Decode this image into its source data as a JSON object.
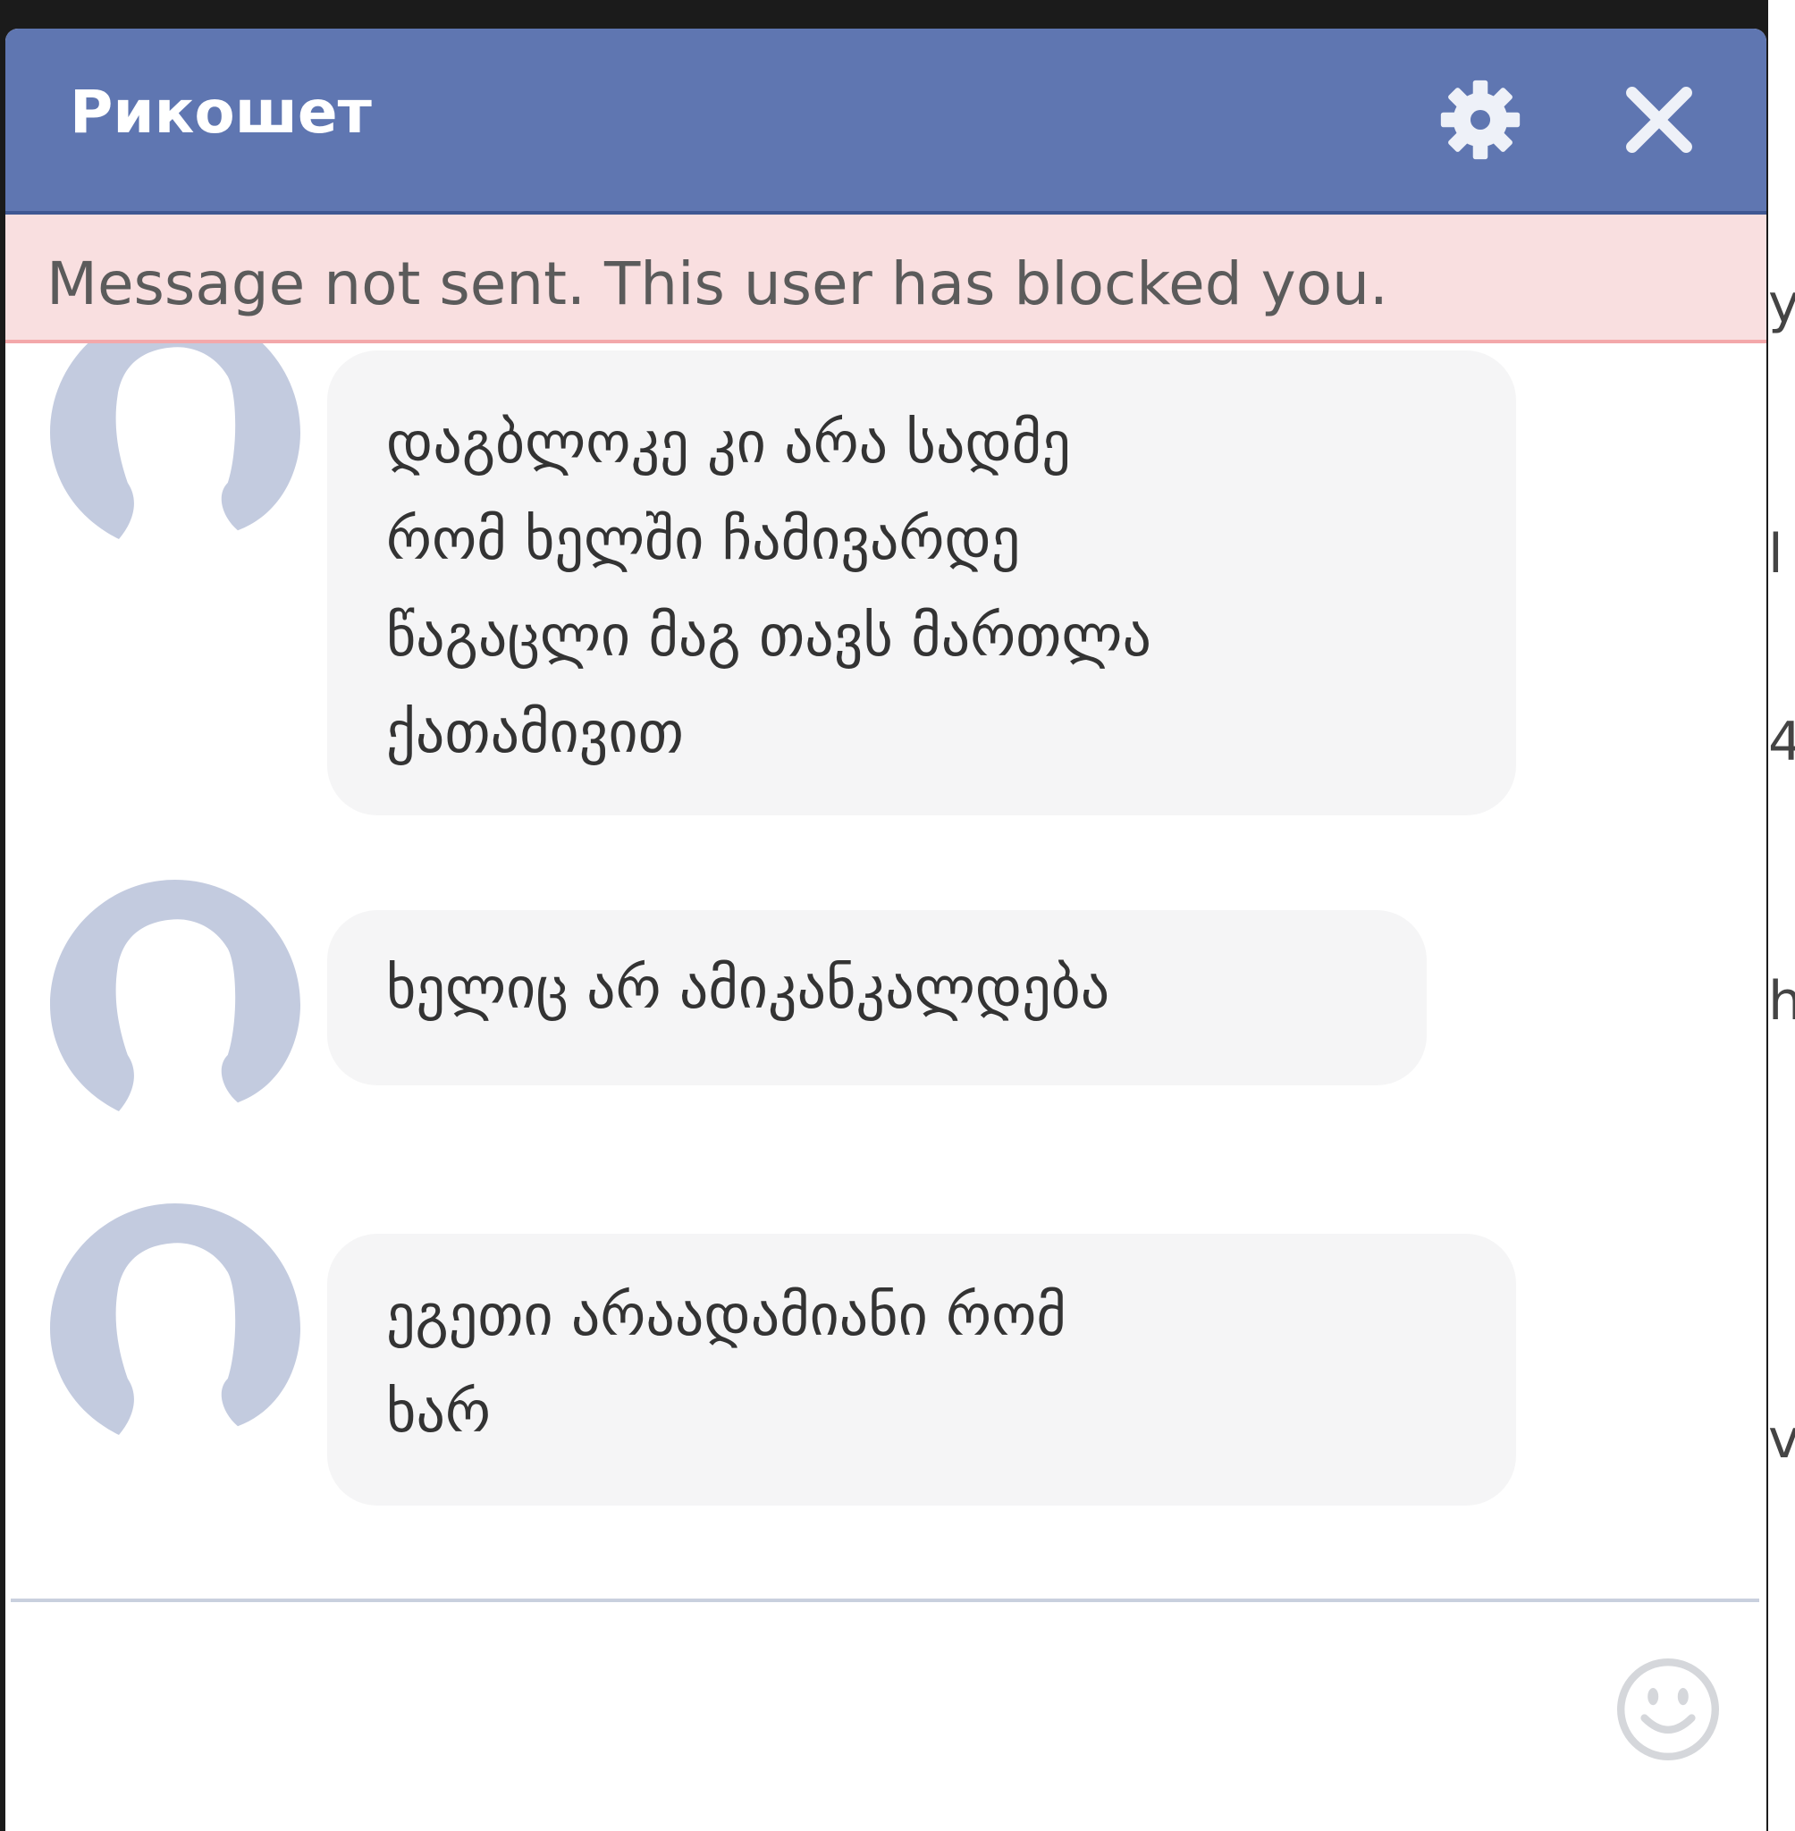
{
  "chat": {
    "title": "Рикошет",
    "settings_icon": "gear-icon",
    "close_icon": "close-icon",
    "alert": "Message not sent. This user has blocked you."
  },
  "messages": [
    {
      "avatar": "default-avatar-silhouette",
      "lines": [
        "დაგბლოკე კი არა სადმე",
        "რომ ხელში ჩამივარდე",
        "წაგაცლი მაგ თავს მართლა",
        "ქათამივით"
      ]
    },
    {
      "avatar": "default-avatar-silhouette",
      "lines": [
        "ხელიც არ ამიკანკალდება"
      ]
    },
    {
      "avatar": "default-avatar-silhouette",
      "lines": [
        "ეგეთი არაადამიანი რომ",
        "ხარ"
      ]
    }
  ],
  "composer": {
    "value": "",
    "emoji_icon": "smiley-icon"
  },
  "background_strip": [
    "y",
    "l",
    "4",
    "hi",
    "v"
  ],
  "colors": {
    "header": "#5f76b1",
    "alert_bg": "#f9dfe0",
    "alert_border": "#f3a8aa",
    "bubble": "#f5f5f6",
    "avatar": "#c3cbdf"
  }
}
